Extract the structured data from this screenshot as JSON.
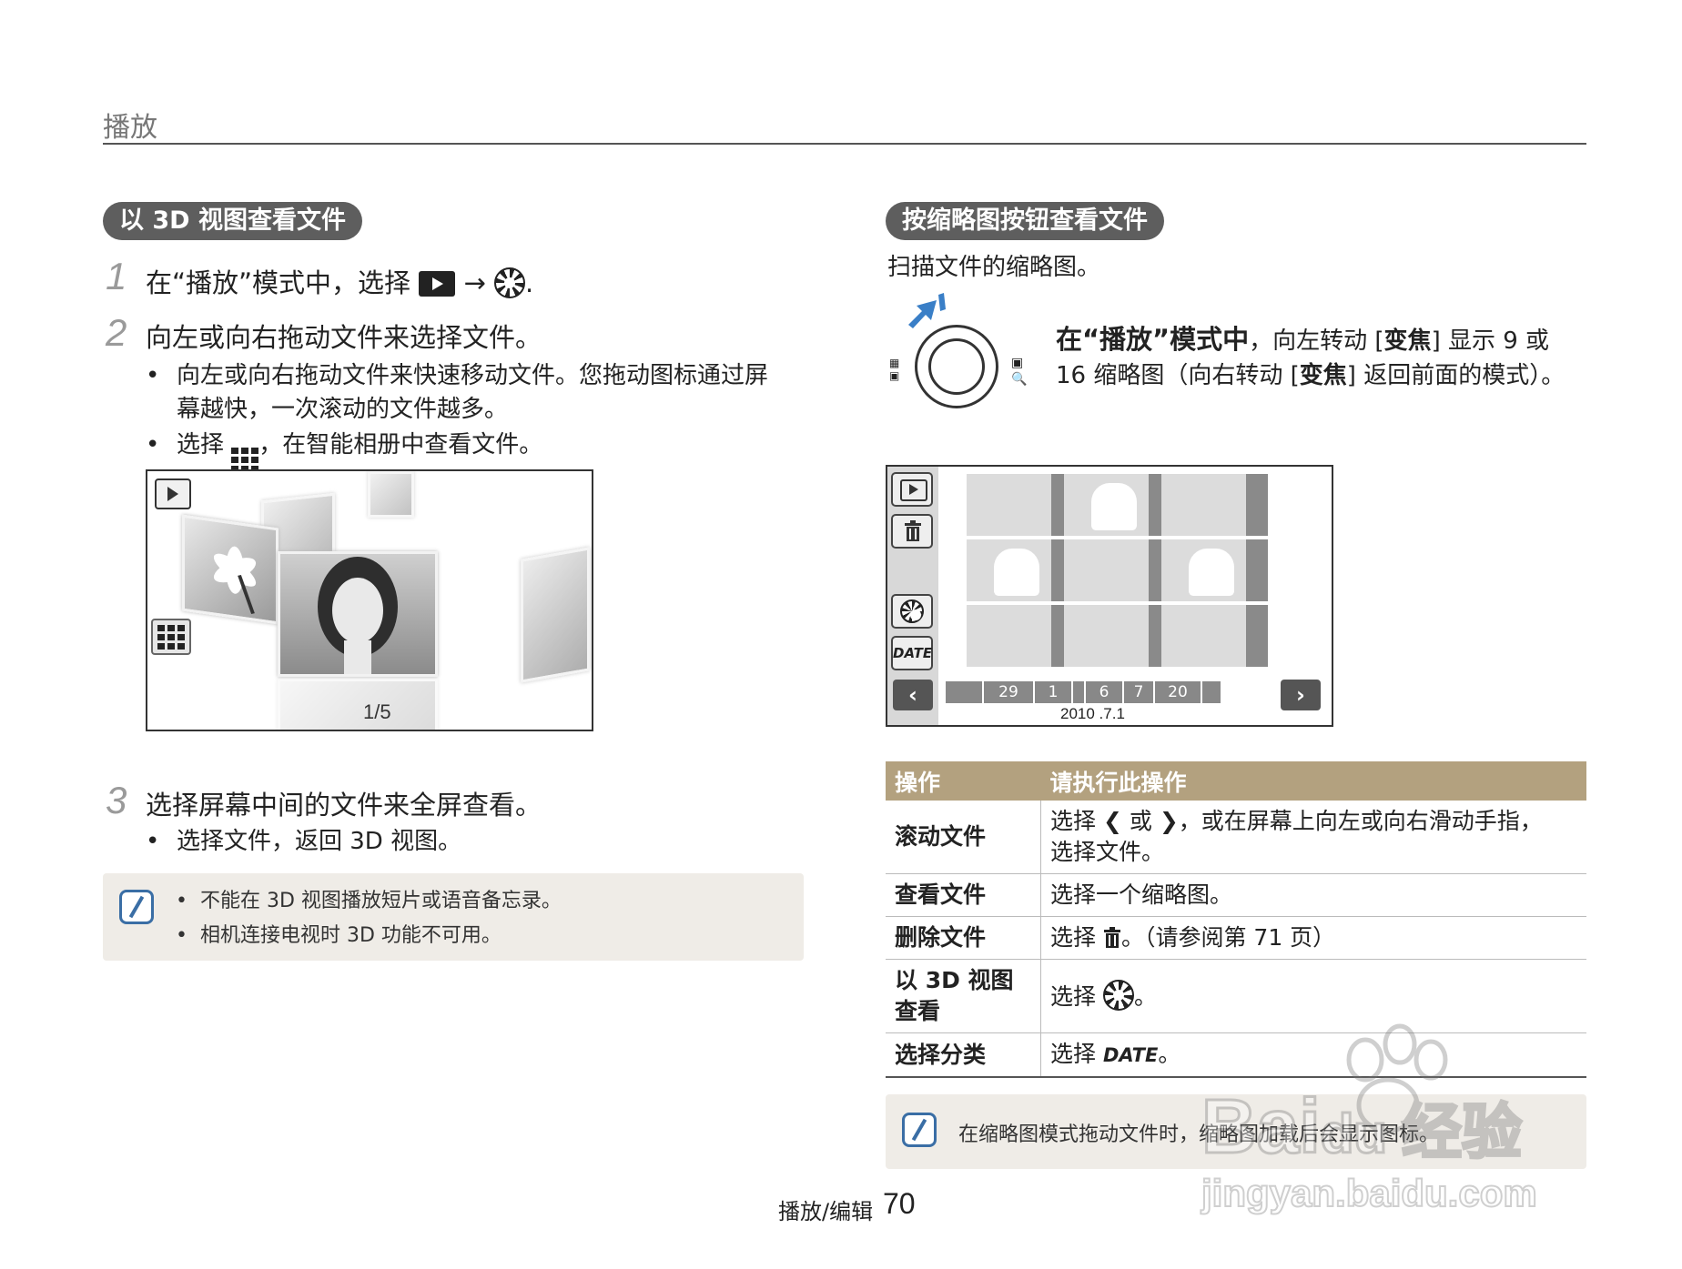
{
  "header": {
    "title": "播放"
  },
  "left": {
    "section_title": "以 3D 视图查看文件",
    "steps": [
      {
        "num": "1",
        "text_a": "在“播放”模式中，选择",
        "arrow": "→",
        "text_end": "."
      },
      {
        "num": "2",
        "text": "向左或向右拖动文件来选择文件。"
      },
      {
        "num": "3",
        "text": "选择屏幕中间的文件来全屏查看。"
      }
    ],
    "step2_bullets": [
      "向左或向右拖动文件来快速移动文件。您拖动图标通过屏",
      "幕越快，一次滚动的文件越多。"
    ],
    "step2_bullet2_a": "选择",
    "step2_bullet2_b": "，在智能相册中查看文件。",
    "screen_counter": "1/5",
    "step3_bullet": "选择文件，返回 3D 视图。",
    "note": [
      "不能在 3D 视图播放短片或语音备忘录。",
      "相机连接电视时 3D 功能不可用。"
    ]
  },
  "right": {
    "section_title": "按缩略图按钮查看文件",
    "intro": "扫描文件的缩略图。",
    "zoom_line1_bold": "在“播放”模式中",
    "zoom_line1_rest_a": "，向左转动 [",
    "zoom_bold": "变焦",
    "zoom_line1_rest_b": "] 显示 9 或",
    "zoom_line2_a": "16 缩略图（向右转动 [",
    "zoom_line2_b": "] 返回前面的模式）。",
    "timeline": [
      "29",
      "1",
      "6",
      "7",
      "20"
    ],
    "timeline_date": "2010 .7.1",
    "date_button": "DATE",
    "table": {
      "headers": [
        "操作",
        "请执行此操作"
      ],
      "rows": [
        {
          "op": "滚动文件",
          "a": "选择",
          "b": "或",
          "c": "，或在屏幕上向左或向右滑动手指，",
          "d": "选择文件。"
        },
        {
          "op": "查看文件",
          "a": "选择一个缩略图。"
        },
        {
          "op": "删除文件",
          "a": "选择",
          "b": "。（请参阅第 71 页）"
        },
        {
          "op1": "以 3D 视图",
          "op2": "查看",
          "a": "选择",
          "b": "。"
        },
        {
          "op": "选择分类",
          "a": "选择",
          "date": "DATE",
          "b": "。"
        }
      ]
    },
    "note": "在缩略图模式拖动文件时，缩略图加载后会显示图标。"
  },
  "footer": {
    "section": "播放/编辑",
    "page": "70"
  },
  "watermark": {
    "brand": "Bai",
    "brand2": "du",
    "cn": "经验",
    "url": "jingyan.baidu.com"
  }
}
